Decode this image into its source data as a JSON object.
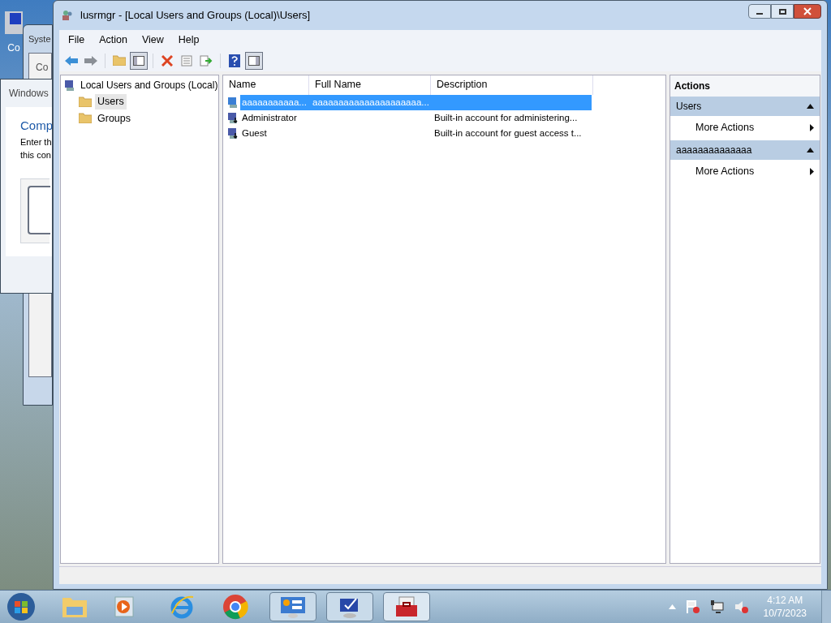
{
  "desktop_icon": {
    "label": "Co"
  },
  "background_windows": [
    {
      "title": "Syste",
      "tab": "Co"
    },
    {
      "title": "Windows",
      "heading": "Comp",
      "lines": [
        "Enter th",
        "this con"
      ]
    }
  ],
  "window": {
    "title": "lusrmgr - [Local Users and Groups (Local)\\Users]"
  },
  "menu": [
    "File",
    "Action",
    "View",
    "Help"
  ],
  "tree": {
    "label": "Local Users and Groups (Local)",
    "children": [
      {
        "label": "Users",
        "selected": true
      },
      {
        "label": "Groups",
        "selected": false
      }
    ]
  },
  "list": {
    "columns": [
      "Name",
      "Full Name",
      "Description"
    ],
    "rows": [
      {
        "name": "aaaaaaaaaaa...",
        "full_name": "aaaaaaaaaaaaaaaaaaaaa...",
        "description": "",
        "selected": true,
        "kind": "user"
      },
      {
        "name": "Administrator",
        "full_name": "",
        "description": "Built-in account for administering...",
        "selected": false,
        "kind": "builtin"
      },
      {
        "name": "Guest",
        "full_name": "",
        "description": "Built-in account for guest access t...",
        "selected": false,
        "kind": "builtin"
      }
    ]
  },
  "actions": {
    "title": "Actions",
    "sections": [
      {
        "title": "Users",
        "expanded": true,
        "items": [
          "More Actions"
        ]
      },
      {
        "title": "aaaaaaaaaaaaaa",
        "expanded": true,
        "items": [
          "More Actions"
        ]
      }
    ]
  },
  "clock": {
    "time": "4:12 AM",
    "date": "10/7/2023"
  }
}
